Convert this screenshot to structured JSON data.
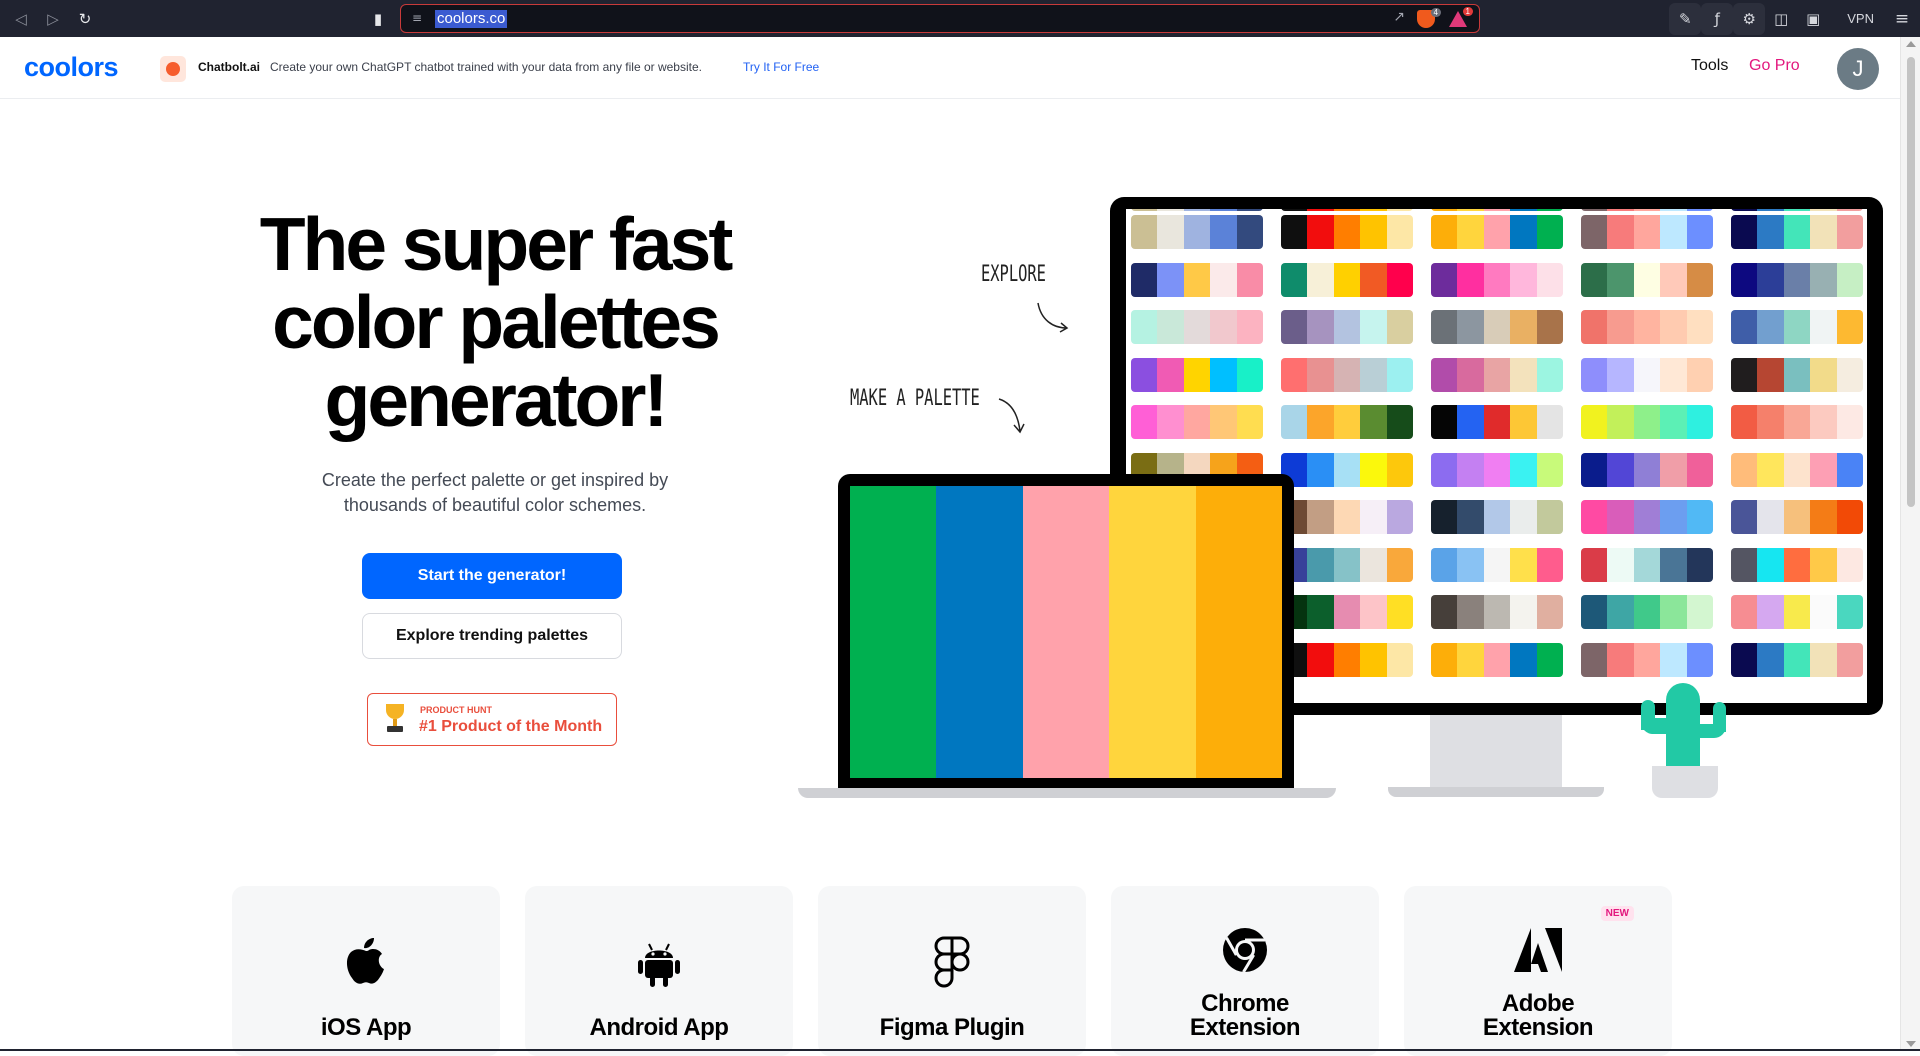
{
  "browser": {
    "url": "coolors.co",
    "shields_count": "4",
    "rewards_count": "1",
    "vpn_label": "VPN"
  },
  "header": {
    "logo": "coolors",
    "ad": {
      "brand": "Chatbolt.ai",
      "text": "Create your own ChatGPT chatbot trained with your data from any file or website.",
      "link": "Try It For Free"
    },
    "nav": {
      "tools": "Tools",
      "go_pro": "Go Pro"
    },
    "avatar_initial": "J"
  },
  "hero": {
    "title_lines": [
      "The super fast",
      "color palettes",
      "generator!"
    ],
    "subtitle_lines": [
      "Create the perfect palette or get inspired by",
      "thousands of beautiful color schemes."
    ],
    "primary_button": "Start the generator!",
    "secondary_button": "Explore trending palettes",
    "badge_small": "PRODUCT HUNT",
    "badge_big": "#1 Product of the Month"
  },
  "illustration": {
    "label_explore": "EXPLORE",
    "label_make": "MAKE A PALETTE",
    "laptop_palette": [
      "#00b050",
      "#0077c0",
      "#ffa2ab",
      "#ffd53d",
      "#fdae09"
    ],
    "monitor_palettes": [
      [
        [
          "#cbbf94",
          "#e9e6dd",
          "#9fb3e0",
          "#5b82d8",
          "#334a7e"
        ],
        [
          "#0f0f0f",
          "#f20d0d",
          "#ff7e00",
          "#ffc300",
          "#fde7a6"
        ],
        [
          "#fdae09",
          "#ffd53d",
          "#ffa2ab",
          "#0077c0",
          "#00b050"
        ],
        [
          "#7d6568",
          "#f77b7b",
          "#ffa69d",
          "#bde8ff",
          "#6c8fff"
        ],
        [
          "#0a0a50",
          "#2c7ac4",
          "#43e5b9",
          "#f2e2b8",
          "#f29e9e"
        ]
      ],
      [
        [
          "#1f2b67",
          "#7c92f7",
          "#ffc947",
          "#fbeaea",
          "#f98ca7"
        ],
        [
          "#0f8c6b",
          "#f7f0d8",
          "#ffd000",
          "#f15a24",
          "#ff004c"
        ],
        [
          "#6d2c9c",
          "#ff2fa0",
          "#ff7ac0",
          "#ffb7dc",
          "#fde0e8"
        ],
        [
          "#2c6e49",
          "#4c956c",
          "#fefee3",
          "#ffc9b9",
          "#d68c45"
        ],
        [
          "#0d0980",
          "#2c3e98",
          "#6a7fa8",
          "#98b0b2",
          "#c6efc4"
        ]
      ],
      [
        [
          "#b5f2e2",
          "#c9e8d9",
          "#e3dada",
          "#f1c8cd",
          "#fcb3c1"
        ],
        [
          "#6b5e8a",
          "#a693bf",
          "#b3c3e0",
          "#c6f4ee",
          "#d9cfa0"
        ],
        [
          "#6b7177",
          "#8c96a0",
          "#d8ccb8",
          "#e9b063",
          "#a8734a"
        ],
        [
          "#f0736a",
          "#f79b8f",
          "#ffb4a0",
          "#ffcbb0",
          "#ffdfc0"
        ],
        [
          "#3f5ea8",
          "#729fcf",
          "#8ed6c3",
          "#f0f4f4",
          "#fdb931"
        ]
      ],
      [
        [
          "#8b4fe0",
          "#f05bb4",
          "#ffd400",
          "#00bfff",
          "#18f0c8"
        ],
        [
          "#ff6f6f",
          "#e89191",
          "#d6b3b3",
          "#b9cfd6",
          "#9cf0f0"
        ],
        [
          "#b14caa",
          "#d86a9e",
          "#e8a4a4",
          "#f3e2bc",
          "#9cf5e1"
        ],
        [
          "#8e8efc",
          "#b6b6ff",
          "#f6f6fb",
          "#ffe8d6",
          "#ffd0b1"
        ],
        [
          "#201d1e",
          "#b64632",
          "#7abfbf",
          "#f2db8a",
          "#f5ede0"
        ]
      ],
      [
        [
          "#ff5fd6",
          "#ff8fd0",
          "#ffa7a0",
          "#ffc776",
          "#ffdd50"
        ],
        [
          "#a9d5e8",
          "#fca52a",
          "#ffcd3c",
          "#5a8c30",
          "#164c1a"
        ],
        [
          "#050505",
          "#2463f2",
          "#e02b2b",
          "#fdc735",
          "#e4e4e4"
        ],
        [
          "#f1f21f",
          "#c2f05a",
          "#8ef08a",
          "#5cf0b5",
          "#2ef0e0"
        ],
        [
          "#f25c44",
          "#f5806b",
          "#f9a796",
          "#fccac0",
          "#fde9e4"
        ]
      ],
      [
        [
          "#7a6d14",
          "#b6b38a",
          "#f4d7bf",
          "#f6a31b",
          "#f45e13"
        ],
        [
          "#0d3bd6",
          "#2a8ff5",
          "#a7e0f5",
          "#fbf80c",
          "#fdc80c"
        ],
        [
          "#8c6cf0",
          "#c480f2",
          "#f07ef2",
          "#3af2f2",
          "#c8fa7a"
        ],
        [
          "#0a1c8c",
          "#5246d6",
          "#8f7fd6",
          "#f09ea8",
          "#f0609a"
        ],
        [
          "#ffbc7a",
          "#ffe65c",
          "#fde3cd",
          "#fd9fb4",
          "#4a83f6"
        ]
      ],
      [
        [
          "#6e4a34",
          "#c29e84",
          "#fdd8b4",
          "#f6eff7",
          "#baa8e0"
        ],
        [
          "#16212d",
          "#334b6b",
          "#b2c8e8",
          "#eaedec",
          "#c2c99c"
        ],
        [
          "#ff4aa3",
          "#d95dba",
          "#a07ed6",
          "#6c9ef0",
          "#51b9f5"
        ],
        [
          "#4a5598",
          "#e4e4eb",
          "#f6c07c",
          "#f47c16",
          "#f24a06"
        ]
      ],
      [
        [
          "#38419a",
          "#4a9aab",
          "#86c2c8",
          "#ebe5dd",
          "#f9a83b"
        ],
        [
          "#5aa3e8",
          "#89c2f3",
          "#f5f5f5",
          "#ffe04b",
          "#ff5c8d"
        ],
        [
          "#da3c48",
          "#edfaf5",
          "#a4d8d9",
          "#4a7596",
          "#23365a"
        ],
        [
          "#545562",
          "#16e6f1",
          "#ff6d3f",
          "#ffc948",
          "#fde8e2"
        ]
      ],
      [
        [
          "#05330f",
          "#0c5f2c",
          "#e68cb0",
          "#fdc4c8",
          "#ffdf24"
        ],
        [
          "#463f3a",
          "#8a817c",
          "#bcb8b1",
          "#f4f3ee",
          "#e0afa0"
        ],
        [
          "#1d5878",
          "#3ea6a5",
          "#40c98a",
          "#8be69a",
          "#d3f6d0"
        ],
        [
          "#f68d92",
          "#d5a8f0",
          "#f8ea4c",
          "#fbfbfb",
          "#4ad7bf"
        ]
      ],
      [
        [
          "#0f0f0f",
          "#f20d0d",
          "#ff7e00",
          "#ffc300",
          "#fde7a6"
        ],
        [
          "#fdae09",
          "#ffd53d",
          "#ffa2ab",
          "#0077c0",
          "#00b050"
        ],
        [
          "#7d6568",
          "#f77b7b",
          "#ffa69d",
          "#bde8ff",
          "#6c8fff"
        ],
        [
          "#0a0a50",
          "#2c7ac4",
          "#43e5b9",
          "#f2e2b8",
          "#f29e9e"
        ]
      ]
    ]
  },
  "products": [
    {
      "title": "iOS App",
      "icon": "apple-icon",
      "new": ""
    },
    {
      "title": "Android App",
      "icon": "android-icon",
      "new": ""
    },
    {
      "title": "Figma Plugin",
      "icon": "figma-icon",
      "new": ""
    },
    {
      "title": "Chrome Extension",
      "icon": "chrome-icon",
      "new": ""
    },
    {
      "title": "Adobe Extension",
      "icon": "adobe-icon",
      "new": "NEW"
    }
  ],
  "colors": {
    "brand_blue": "#0066ff",
    "pro_pink": "#e3187e",
    "badge_red": "#e94e3c",
    "cactus": "#22c9a5"
  }
}
